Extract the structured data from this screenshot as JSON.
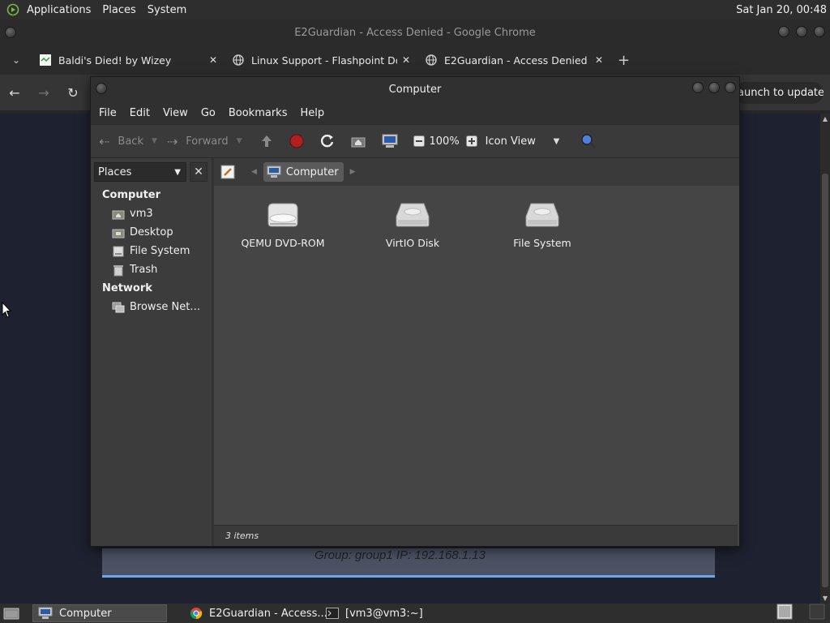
{
  "top_panel": {
    "menus": [
      "Applications",
      "Places",
      "System"
    ],
    "clock": "Sat Jan 20, 00:48"
  },
  "chrome": {
    "window_title": "E2Guardian - Access Denied - Google Chrome",
    "tabs": [
      {
        "label": "Baldi's Died! by Wizey"
      },
      {
        "label": "Linux Support - Flashpoint Do"
      },
      {
        "label": "E2Guardian - Access Denied"
      }
    ],
    "update_button": "Relaunch to update",
    "page_info": "Group: group1   IP: 192.168.1.13"
  },
  "file_manager": {
    "title": "Computer",
    "menus": [
      "File",
      "Edit",
      "View",
      "Go",
      "Bookmarks",
      "Help"
    ],
    "toolbar": {
      "back": "Back",
      "forward": "Forward",
      "zoom": "100%",
      "view_mode": "Icon View"
    },
    "sidebar": {
      "selector": "Places",
      "headings": {
        "computer": "Computer",
        "network": "Network"
      },
      "items": [
        {
          "label": "vm3",
          "icon": "home-folder-icon"
        },
        {
          "label": "Desktop",
          "icon": "desktop-folder-icon"
        },
        {
          "label": "File System",
          "icon": "drive-icon"
        },
        {
          "label": "Trash",
          "icon": "trash-icon"
        }
      ],
      "network_items": [
        {
          "label": "Browse Net…",
          "icon": "network-icon"
        }
      ]
    },
    "path": {
      "crumb": "Computer"
    },
    "items": [
      {
        "label": "QEMU DVD-ROM",
        "icon": "optical-drive-icon"
      },
      {
        "label": "VirtIO Disk",
        "icon": "hard-disk-icon"
      },
      {
        "label": "File System",
        "icon": "hard-disk-icon"
      }
    ],
    "status": "3 items"
  },
  "taskbar": {
    "tasks": [
      {
        "label": "Computer"
      },
      {
        "label": "E2Guardian - Access..."
      },
      {
        "label": "[vm3@vm3:~]"
      }
    ]
  },
  "colors": {
    "page_bg": "#1e2230",
    "info_box": "#4c5263",
    "info_border": "#6aa8e8",
    "stop_red": "#b02020"
  }
}
